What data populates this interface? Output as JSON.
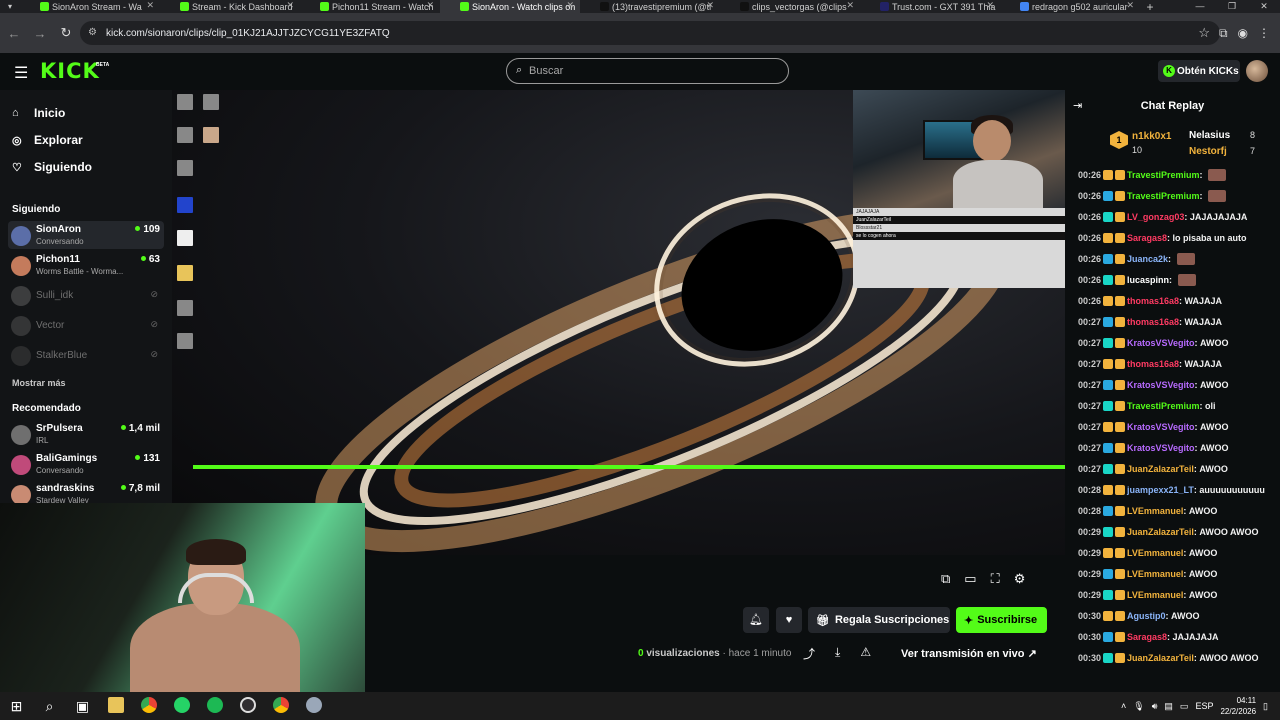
{
  "browser": {
    "tabs": [
      {
        "title": "SionAron Stream - Wa",
        "active": false,
        "favicon_color": "#53fc18"
      },
      {
        "title": "Stream - Kick Dashboard",
        "active": false,
        "favicon_color": "#53fc18"
      },
      {
        "title": "Pichon11 Stream - Watch",
        "active": false,
        "favicon_color": "#53fc18"
      },
      {
        "title": "SionAron - Watch clips on",
        "active": true,
        "favicon_color": "#53fc18"
      },
      {
        "title": "(13)travestipremium (@ti",
        "active": false,
        "favicon_color": "#111111"
      },
      {
        "title": "clips_vectorgas (@clips",
        "active": false,
        "favicon_color": "#111111"
      },
      {
        "title": "Trust.com - GXT 391 Thia",
        "active": false,
        "favicon_color": "#222266"
      },
      {
        "title": "redragon g502 auricular",
        "active": false,
        "favicon_color": "#4285f4"
      }
    ],
    "url": "kick.com/sionaron/clips/clip_01KJ21AJJTJZCYCG11YE3ZFATQ"
  },
  "header": {
    "logo": "KICK",
    "logo_badge": "BETA",
    "search_placeholder": "Buscar",
    "kicks_button": "Obtén KICKs"
  },
  "sidebar": {
    "nav": [
      {
        "label": "Inicio",
        "icon": "home-icon"
      },
      {
        "label": "Explorar",
        "icon": "compass-icon"
      },
      {
        "label": "Siguiendo",
        "icon": "heart-icon"
      }
    ],
    "following_title": "Siguiendo",
    "following": [
      {
        "name": "SionAron",
        "sub": "Conversando",
        "viewers": "109",
        "live": true,
        "color": "#5b6ea8"
      },
      {
        "name": "Pichon11",
        "sub": "Worms Battle - Worma...",
        "viewers": "63",
        "live": true,
        "color": "#c47b5c"
      },
      {
        "name": "Sulli_idk",
        "sub": "",
        "viewers": "",
        "live": false,
        "color": "#666"
      },
      {
        "name": "Vector",
        "sub": "",
        "viewers": "",
        "live": false,
        "color": "#555"
      },
      {
        "name": "StalkerBlue",
        "sub": "",
        "viewers": "",
        "live": false,
        "color": "#444"
      }
    ],
    "show_more": "Mostrar más",
    "recommended_title": "Recomendado",
    "recommended": [
      {
        "name": "SrPulsera",
        "sub": "IRL",
        "viewers": "1,4 mil",
        "color": "#6f6f6f"
      },
      {
        "name": "BaliGamings",
        "sub": "Conversando",
        "viewers": "131",
        "color": "#c04a7a"
      },
      {
        "name": "sandraskins",
        "sub": "Stardew Valley",
        "viewers": "7,8 mil",
        "color": "#c98b73"
      }
    ]
  },
  "overlay": {
    "chat_lines": [
      "JAJAJAJA",
      "JuanZalazarTeil",
      "Blossstar21",
      "se lo cogen ahora"
    ]
  },
  "actions": {
    "gift_label": "Regala Suscripciones",
    "subscribe_label": "Suscribirse",
    "views_count": "0",
    "views_label": "visualizaciones",
    "time_ago": "hace 1 minuto",
    "live_link": "Ver transmisión en vivo"
  },
  "chat": {
    "title": "Chat Replay",
    "leaderboard": [
      {
        "name": "n1kk0x1",
        "value": "10",
        "color": "#f2b33d"
      },
      {
        "name": "Nelasius",
        "value": "8",
        "color": "#ffffff"
      },
      {
        "name": "Nestorfj",
        "value": "7",
        "color": "#f2b33d"
      }
    ],
    "messages": [
      {
        "ts": "00:26",
        "user": "TravestiPremium",
        "msg": "",
        "color": "#53fc18",
        "emote": true
      },
      {
        "ts": "00:26",
        "user": "TravestiPremium",
        "msg": "",
        "color": "#53fc18",
        "emote": true
      },
      {
        "ts": "00:26",
        "user": "LV_gonzag03",
        "msg": "JAJAJAJAJA",
        "color": "#ff3b63",
        "emote": false
      },
      {
        "ts": "00:26",
        "user": "Saragas8",
        "msg": "lo pisaba un auto",
        "color": "#ff3b63",
        "emote": false
      },
      {
        "ts": "00:26",
        "user": "Juanca2k",
        "msg": "",
        "color": "#8ab4f8",
        "emote": true
      },
      {
        "ts": "00:26",
        "user": "lucaspinn",
        "msg": "",
        "color": "#ffffff",
        "emote": true
      },
      {
        "ts": "00:26",
        "user": "thomas16a8",
        "msg": "WAJAJA",
        "color": "#ff3b63",
        "emote": false
      },
      {
        "ts": "00:27",
        "user": "thomas16a8",
        "msg": "WAJAJA",
        "color": "#ff3b63",
        "emote": false
      },
      {
        "ts": "00:27",
        "user": "KratosVSVegito",
        "msg": "AWOO",
        "color": "#b86bff",
        "emote": false
      },
      {
        "ts": "00:27",
        "user": "thomas16a8",
        "msg": "WAJAJA",
        "color": "#ff3b63",
        "emote": false
      },
      {
        "ts": "00:27",
        "user": "KratosVSVegito",
        "msg": "AWOO",
        "color": "#b86bff",
        "emote": false
      },
      {
        "ts": "00:27",
        "user": "TravestiPremium",
        "msg": "oli",
        "color": "#53fc18",
        "emote": false
      },
      {
        "ts": "00:27",
        "user": "KratosVSVegito",
        "msg": "AWOO",
        "color": "#b86bff",
        "emote": false
      },
      {
        "ts": "00:27",
        "user": "KratosVSVegito",
        "msg": "AWOO",
        "color": "#b86bff",
        "emote": false
      },
      {
        "ts": "00:27",
        "user": "JuanZalazarTeil",
        "msg": "AWOO",
        "color": "#f2b33d",
        "emote": false
      },
      {
        "ts": "00:28",
        "user": "juampexx21_LT",
        "msg": "auuuuuuuuuuu",
        "color": "#8ab4f8",
        "emote": false
      },
      {
        "ts": "00:28",
        "user": "LVEmmanuel",
        "msg": "AWOO",
        "color": "#f2b33d",
        "emote": false
      },
      {
        "ts": "00:29",
        "user": "JuanZalazarTeil",
        "msg": "AWOO AWOO",
        "color": "#f2b33d",
        "emote": false
      },
      {
        "ts": "00:29",
        "user": "LVEmmanuel",
        "msg": "AWOO",
        "color": "#f2b33d",
        "emote": false
      },
      {
        "ts": "00:29",
        "user": "LVEmmanuel",
        "msg": "AWOO",
        "color": "#f2b33d",
        "emote": false
      },
      {
        "ts": "00:29",
        "user": "LVEmmanuel",
        "msg": "AWOO",
        "color": "#f2b33d",
        "emote": false
      },
      {
        "ts": "00:30",
        "user": "Agustip0",
        "msg": "AWOO",
        "color": "#8ab4f8",
        "emote": false
      },
      {
        "ts": "00:30",
        "user": "Saragas8",
        "msg": "JAJAJAJA",
        "color": "#ff3b63",
        "emote": false
      },
      {
        "ts": "00:30",
        "user": "JuanZalazarTeil",
        "msg": "AWOO AWOO",
        "color": "#f2b33d",
        "emote": false
      }
    ]
  },
  "taskbar": {
    "lang": "ESP",
    "time": "04:11",
    "date": "22/2/2026"
  }
}
